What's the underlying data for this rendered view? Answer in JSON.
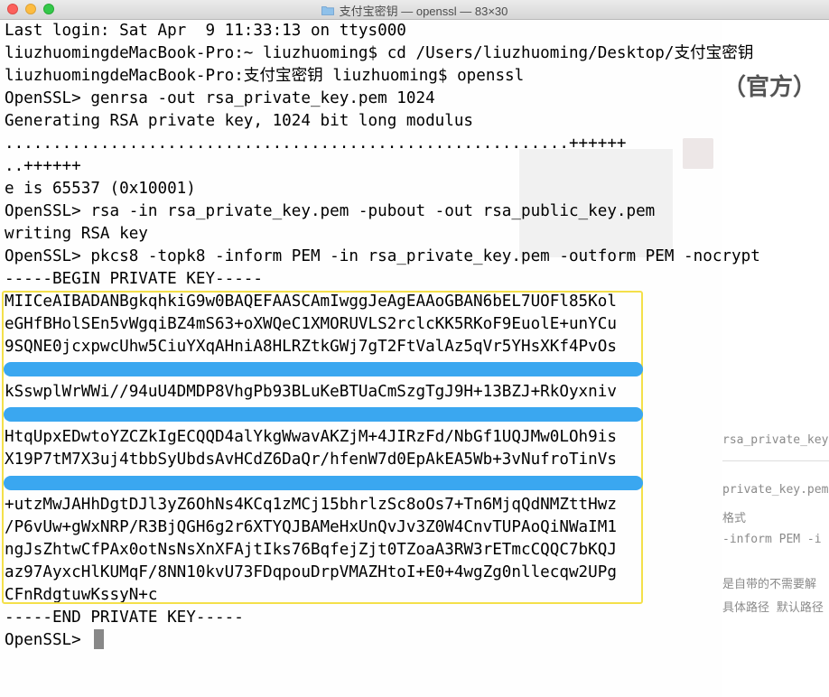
{
  "window": {
    "title": "支付宝密钥 — openssl — 83×30"
  },
  "background_page": {
    "heading": "（官方）",
    "lines": [
      "rsa_private_key",
      "private_key.pem",
      "格式",
      "-inform PEM -i",
      "是自带的不需要解",
      "具体路径 默认路径"
    ]
  },
  "terminal": {
    "lines": [
      "Last login: Sat Apr  9 11:33:13 on ttys000",
      "liuzhuomingdeMacBook-Pro:~ liuzhuoming$ cd /Users/liuzhuoming/Desktop/支付宝密钥",
      "liuzhuomingdeMacBook-Pro:支付宝密钥 liuzhuoming$ openssl",
      "OpenSSL> genrsa -out rsa_private_key.pem 1024",
      "Generating RSA private key, 1024 bit long modulus",
      "...........................................................++++++",
      "..++++++",
      "e is 65537 (0x10001)",
      "OpenSSL> rsa -in rsa_private_key.pem -pubout -out rsa_public_key.pem",
      "writing RSA key",
      "OpenSSL> pkcs8 -topk8 -inform PEM -in rsa_private_key.pem -outform PEM -nocrypt",
      "-----BEGIN PRIVATE KEY-----",
      "MIICeAIBADANBgkqhkiG9w0BAQEFAASCAmIwggJeAgEAAoGBAN6bEL7UOFl85Kol",
      "eGHfBHolSEn5vWgqiBZ4mS63+oXWQeC1XMORUVLS2rclcKK5RKoF9EuolE+unYCu",
      "9SQNE0jcxpwcUhw5CiuYXqAHniA8HLRZtkGWj7gT2FtValAz5qVr5YHsXKf4PvOs",
      "",
      "kSswplWrWWi//94uU4DMDP8VhgPb93BLuKeBTUaCmSzgTgJ9H+13BZJ+RkOyxniv",
      "",
      "HtqUpxEDwtoYZCZkIgECQQD4alYkgWwavAKZjM+4JIRzFd/NbGf1UQJMw0LOh9is",
      "X19P7tM7X3uj4tbbSyUbdsAvHCdZ6DaQr/hfenW7d0EpAkEA5Wb+3vNufroTinVs",
      "",
      "+utzMwJAHhDgtDJl3yZ6OhNs4KCq1zMCj15bhrlzSc8oOs7+Tn6MjqQdNMZttHwz",
      "/P6vUw+gWxNRP/R3BjQGH6g2r6XTYQJBAMeHxUnQvJv3Z0W4CnvTUPAoQiNWaIM1",
      "ngJsZhtwCfPAx0otNsNsXnXFAjtIks76BqfejZjt0TZoaA3RW3rETmcCQQC7bKQJ",
      "az97AyxcHlKUMqF/8NN10kvU73FDqpouDrpVMAZHtoI+E0+4wgZg0nllecqw2UPg",
      "CFnRdgtuwKssyN+c",
      "-----END PRIVATE KEY-----",
      "OpenSSL> "
    ]
  },
  "colors": {
    "highlight_border": "#f4e04a",
    "redaction": "#3aa7f0",
    "cursor": "#888888"
  },
  "icons": {
    "title_folder": "folder-icon"
  }
}
